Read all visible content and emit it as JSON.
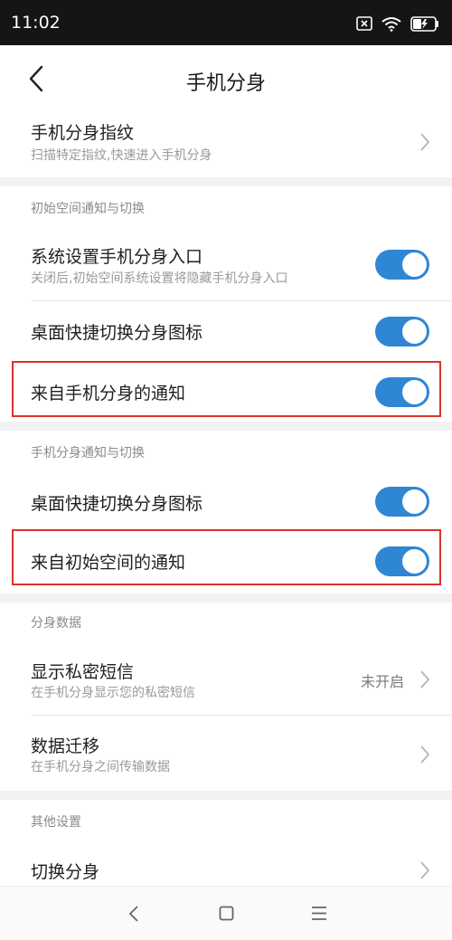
{
  "status_bar": {
    "time": "11:02",
    "icons": [
      "close-box-icon",
      "wifi-icon",
      "battery-charging-icon"
    ]
  },
  "header": {
    "title": "手机分身",
    "back_icon": "chevron-left-icon"
  },
  "rows": {
    "fingerprint": {
      "title": "手机分身指纹",
      "subtitle": "扫描特定指纹,快速进入手机分身"
    },
    "section1": {
      "label": "初始空间通知与切换"
    },
    "settings_entry": {
      "title": "系统设置手机分身入口",
      "subtitle": "关闭后,初始空间系统设置将隐藏手机分身入口",
      "enabled": true
    },
    "desktop_switch_1": {
      "title": "桌面快捷切换分身图标",
      "enabled": true
    },
    "notify_from_clone": {
      "title": "来自手机分身的通知",
      "enabled": true
    },
    "section2": {
      "label": "手机分身通知与切换"
    },
    "desktop_switch_2": {
      "title": "桌面快捷切换分身图标",
      "enabled": true
    },
    "notify_from_initial": {
      "title": "来自初始空间的通知",
      "enabled": true
    },
    "section3": {
      "label": "分身数据"
    },
    "private_sms": {
      "title": "显示私密短信",
      "subtitle": "在手机分身显示您的私密短信",
      "value": "未开启"
    },
    "data_migration": {
      "title": "数据迁移",
      "subtitle": "在手机分身之间传输数据"
    },
    "section4": {
      "label": "其他设置"
    },
    "switch_clone": {
      "title": "切换分身"
    }
  },
  "nav_bar": {
    "icons": [
      "back-triangle-icon",
      "home-square-icon",
      "menu-lines-icon"
    ]
  },
  "colors": {
    "toggle_on": "#2f86d3",
    "highlight": "#d8332b",
    "status_bar_bg": "#151515",
    "section_gap_bg": "#f2f2f2"
  }
}
